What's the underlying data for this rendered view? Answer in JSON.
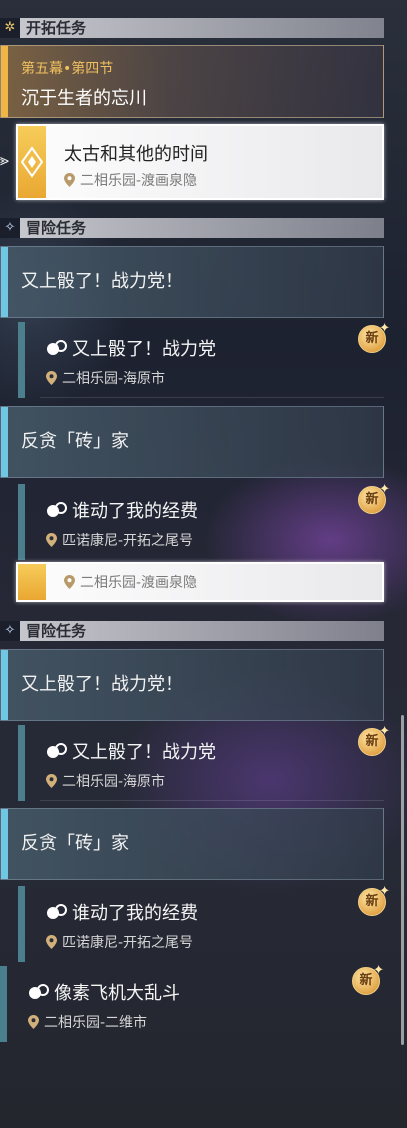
{
  "trailblaze": {
    "header": "开拓任务",
    "chapter": "第五幕•第四节",
    "title": "沉于生者的忘川",
    "selected_quest": "太古和其他的时间",
    "selected_location": "二相乐园-渡画泉隐"
  },
  "adventure": {
    "header": "冒险任务",
    "cat1": "又上骰了！战力党！",
    "q1_name": "又上骰了！战力党",
    "q1_loc": "二相乐园-海原市",
    "cat2": "反贪「砖」家",
    "q2_name": "谁动了我的经费",
    "q2_loc": "匹诺康尼-开拓之尾号",
    "q3_name": "像素飞机大乱斗",
    "q3_loc": "二相乐园-二维市",
    "new_badge": "新"
  },
  "lower": {
    "selected_location": "二相乐园-渡画泉隐",
    "header": "冒险任务",
    "cat1": "又上骰了！战力党！",
    "q1_name": "又上骰了！战力党",
    "q1_loc": "二相乐园-海原市",
    "cat2": "反贪「砖」家",
    "q2_name": "谁动了我的经费",
    "q2_loc": "匹诺康尼-开拓之尾号",
    "q3_name": "像素飞机大乱斗",
    "q3_loc": "二相乐园-二维市"
  },
  "colors": {
    "gold": "#efb545",
    "cyan": "#6fc7e4",
    "teal_bar": "#4b7f8e"
  }
}
